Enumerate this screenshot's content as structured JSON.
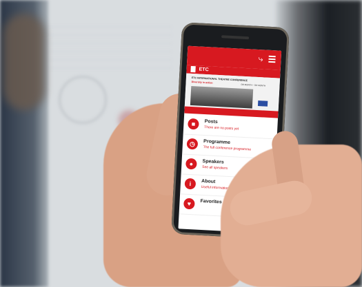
{
  "app": {
    "brand": "ETC",
    "banner": {
      "title": "ETC INTERNATIONAL THEATRE CONFERENCE",
      "subtitle": "Diversity in action",
      "dates": "DD MONTH – DD MONTH"
    },
    "menu": [
      {
        "label": "Posts",
        "description": "There are no posts yet",
        "icon": "chat-icon"
      },
      {
        "label": "Programme",
        "description": "The full conference programme",
        "icon": "clock-icon"
      },
      {
        "label": "Speakers",
        "description": "See all speakers",
        "icon": "people-icon"
      },
      {
        "label": "About",
        "description": "Useful information",
        "icon": "info-icon"
      },
      {
        "label": "Favorites",
        "description": "",
        "icon": "heart-icon"
      }
    ],
    "toolbar_icons": [
      "share-icon",
      "menu-icon"
    ],
    "colors": {
      "accent": "#d71920"
    }
  }
}
